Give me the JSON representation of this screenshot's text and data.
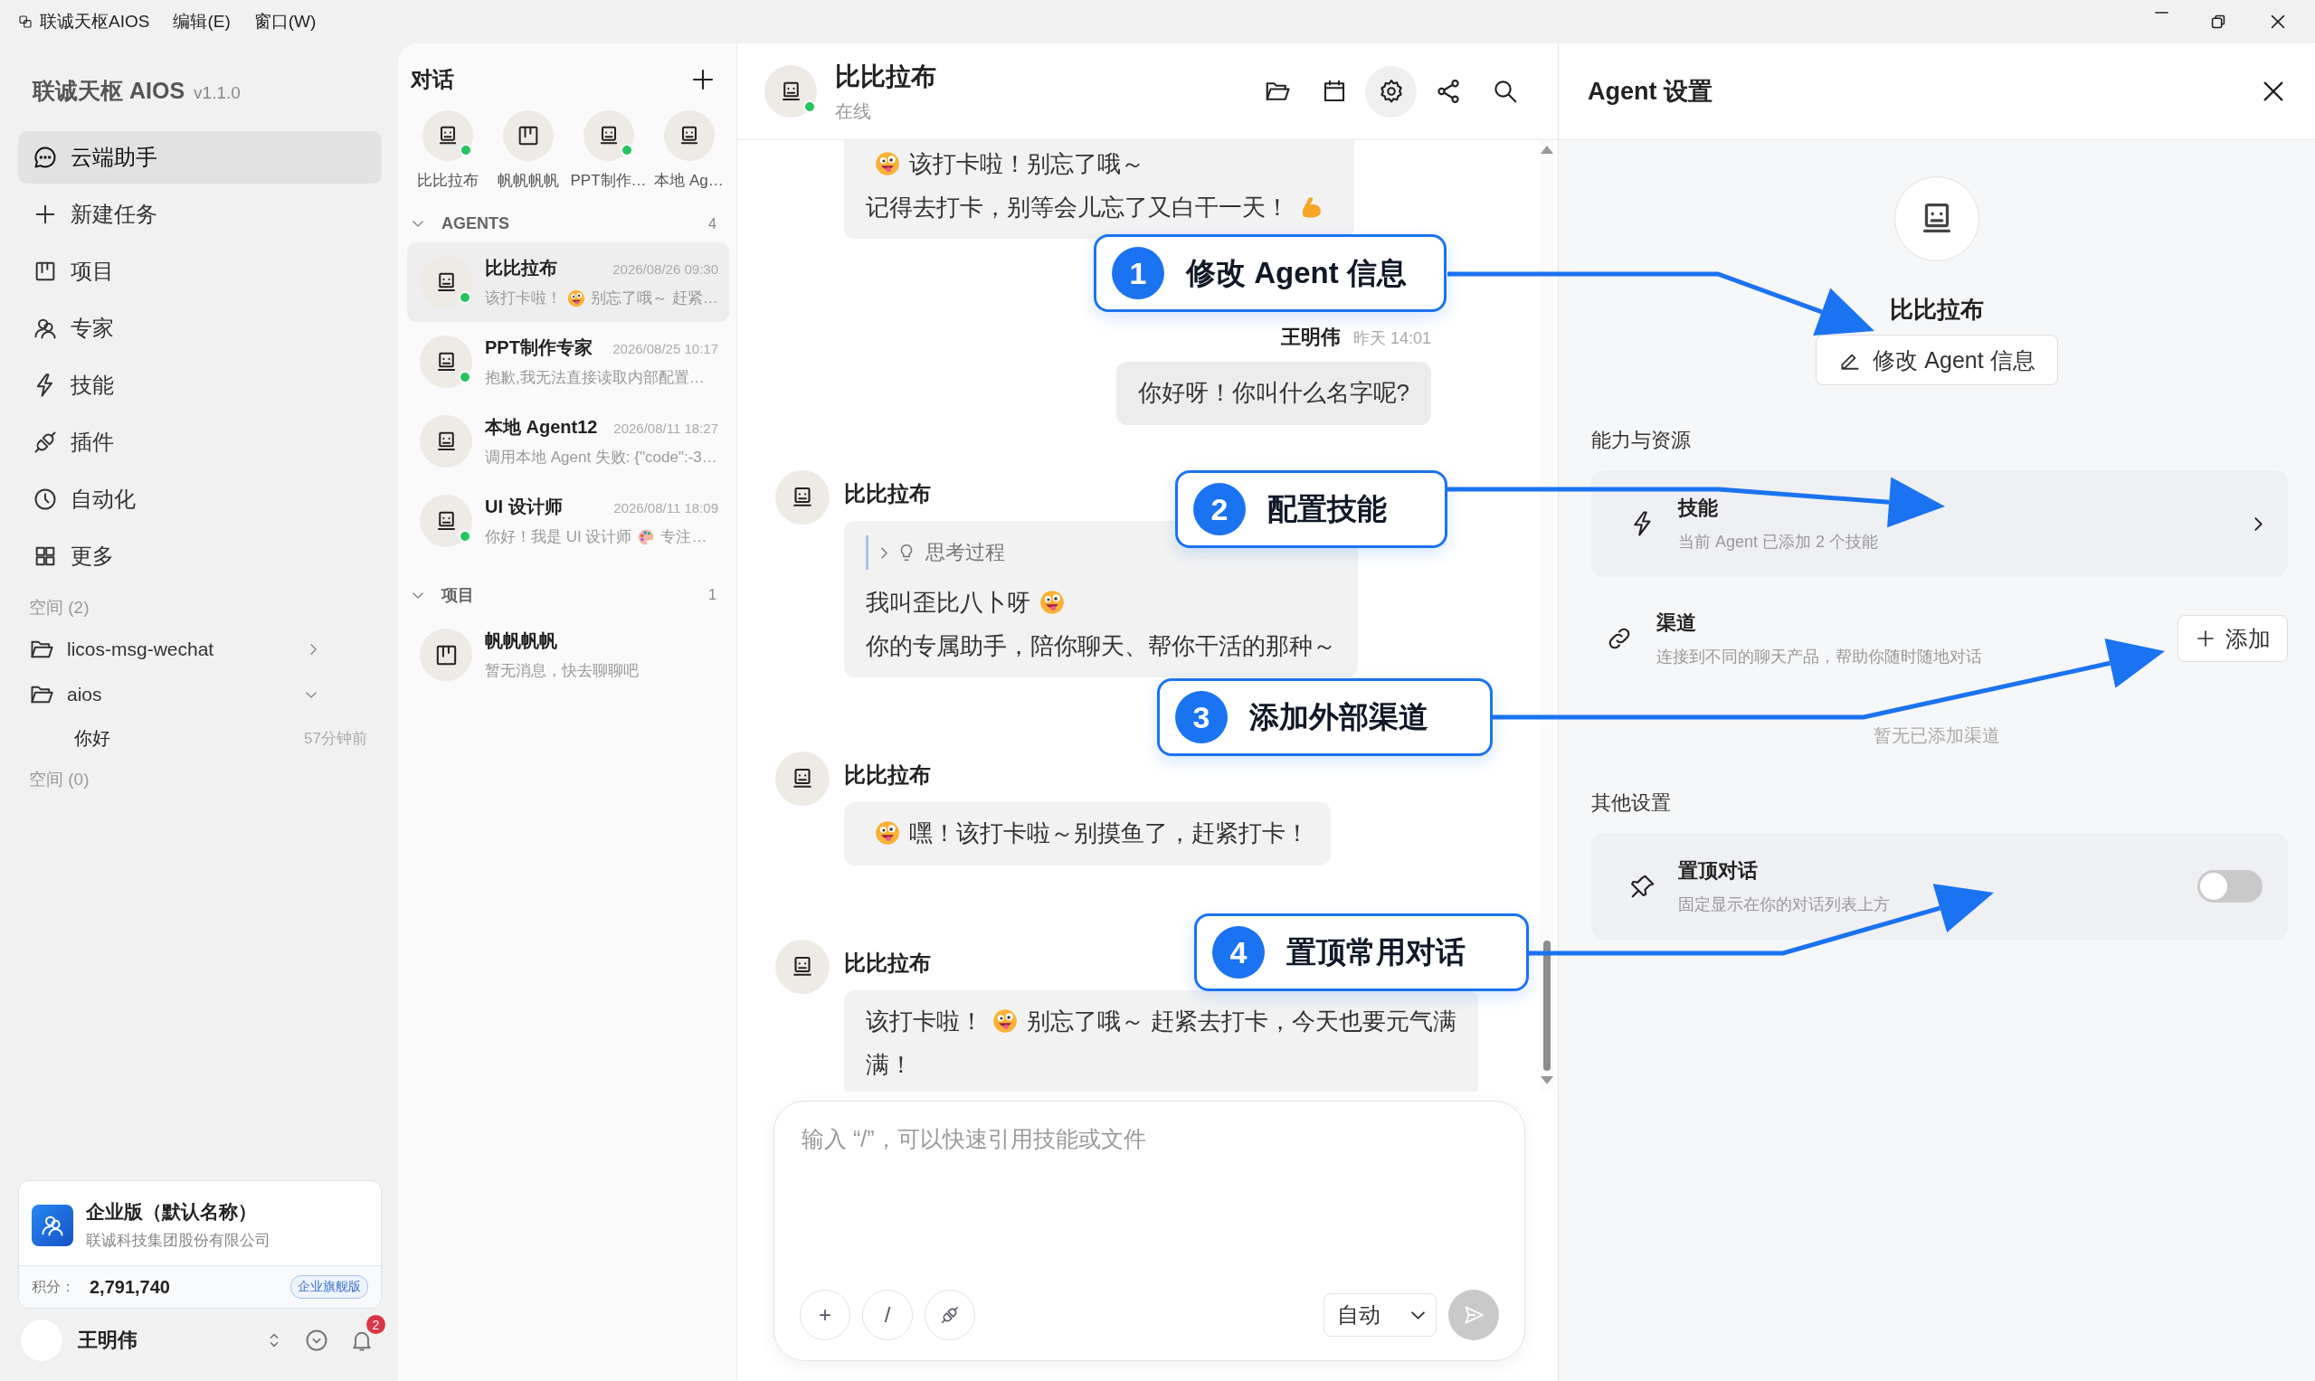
{
  "menu_bar": {
    "app": "联诚天枢AIOS",
    "items": [
      "编辑(E)",
      "窗口(W)"
    ]
  },
  "sidebar": {
    "brand": "联诚天枢 AIOS",
    "version": "v1.1.0",
    "nav": [
      {
        "label": "云端助手",
        "selected": true
      },
      {
        "label": "新建任务",
        "selected": false
      },
      {
        "label": "项目",
        "selected": false
      },
      {
        "label": "专家",
        "selected": false
      },
      {
        "label": "技能",
        "selected": false
      },
      {
        "label": "插件",
        "selected": false
      },
      {
        "label": "自动化",
        "selected": false
      },
      {
        "label": "更多",
        "selected": false
      }
    ],
    "spaces": [
      {
        "heading": "空间 (2)",
        "folders": [
          {
            "name": "licos-msg-wechat",
            "expanded": false
          },
          {
            "name": "aios",
            "expanded": true,
            "children": [
              {
                "title": "你好",
                "time": "57分钟前"
              }
            ]
          }
        ]
      },
      {
        "heading": "空间 (0)"
      }
    ],
    "org_card": {
      "name": "企业版（默认名称）",
      "company": "联诚科技集团股份有限公司",
      "points_label": "积分：",
      "points": "2,791,740",
      "plan": "企业旗舰版"
    },
    "user": {
      "name": "王明伟",
      "notifications": "2"
    }
  },
  "conversations": {
    "title": "对话",
    "recent": [
      {
        "label": "比比拉布",
        "kind": "agent",
        "online": true
      },
      {
        "label": "帆帆帆帆",
        "kind": "project",
        "online": false
      },
      {
        "label": "PPT制作…",
        "kind": "agent",
        "online": true
      },
      {
        "label": "本地 Ag…",
        "kind": "agent",
        "online": false
      }
    ],
    "groups": [
      {
        "title": "AGENTS",
        "count": "4",
        "expanded": true,
        "items": [
          {
            "name": "比比拉布",
            "time": "2026/08/26 09:30",
            "kind": "agent",
            "online": true,
            "selected": true,
            "preview": [
              {
                "kind": "text",
                "text": "该打卡啦！"
              },
              {
                "kind": "face"
              },
              {
                "kind": "text",
                "text": "别忘了哦～ 赶紧…"
              }
            ]
          },
          {
            "name": "PPT制作专家",
            "time": "2026/08/25 10:17",
            "kind": "agent",
            "online": true,
            "selected": false,
            "preview": [
              {
                "kind": "text",
                "text": "抱歉,我无法直接读取内部配置…"
              }
            ]
          },
          {
            "name": "本地 Agent12",
            "time": "2026/08/11 18:27",
            "kind": "agent",
            "online": false,
            "selected": false,
            "preview": [
              {
                "kind": "text",
                "text": "调用本地 Agent 失败: {\"code\":-3…"
              }
            ]
          },
          {
            "name": "UI 设计师",
            "time": "2026/08/11 18:09",
            "kind": "agent",
            "online": true,
            "selected": false,
            "preview": [
              {
                "kind": "text",
                "text": "你好！我是 UI 设计师"
              },
              {
                "kind": "palette"
              },
              {
                "kind": "text",
                "text": "专注…"
              }
            ]
          }
        ]
      },
      {
        "title": "项目",
        "count": "1",
        "expanded": true,
        "items": [
          {
            "name": "帆帆帆帆",
            "kind": "project",
            "online": false,
            "selected": false,
            "preview": [
              {
                "kind": "text",
                "text": "暂无消息，快去聊聊吧"
              }
            ]
          }
        ]
      }
    ]
  },
  "chat": {
    "name": "比比拉布",
    "status": "在线",
    "online": true,
    "tools": [
      {
        "selected": false
      },
      {
        "selected": false
      },
      {
        "selected": true
      },
      {
        "selected": false
      },
      {
        "selected": false
      }
    ],
    "messages": [
      {
        "kind": "agent",
        "lines": [
          [
            {
              "kind": "face"
            },
            {
              "kind": "text",
              "text": "该打卡啦！别忘了哦～"
            }
          ],
          [
            {
              "kind": "text",
              "text": "记得去打卡，别等会儿忘了又白干一天！"
            },
            {
              "kind": "muscle"
            }
          ]
        ]
      },
      {
        "kind": "user",
        "sender": "王明伟",
        "time": "昨天 14:01",
        "lines": [
          [
            {
              "kind": "text",
              "text": "你好呀！你叫什么名字呢?"
            }
          ]
        ]
      },
      {
        "kind": "agent",
        "sender": "比比拉布",
        "thinking": {
          "label": "思考过程",
          "expanded": false
        },
        "lines": [
          [
            {
              "kind": "text",
              "text": "我叫歪比八卜呀"
            },
            {
              "kind": "face"
            }
          ],
          [
            {
              "kind": "text",
              "text": "你的专属助手，陪你聊天、帮你干活的那种～"
            }
          ]
        ]
      },
      {
        "kind": "agent",
        "sender": "比比拉布",
        "lines": [
          [
            {
              "kind": "face"
            },
            {
              "kind": "text",
              "text": "嘿！该打卡啦～别摸鱼了，赶紧打卡！"
            }
          ]
        ]
      },
      {
        "kind": "agent",
        "sender": "比比拉布",
        "lines": [
          [
            {
              "kind": "text",
              "text": "该打卡啦！"
            },
            {
              "kind": "face"
            },
            {
              "kind": "text",
              "text": "别忘了哦～ 赶紧去打卡，今天也要元气满"
            }
          ],
          [
            {
              "kind": "text",
              "text": "满！"
            }
          ]
        ]
      }
    ],
    "input": {
      "placeholder": "输入 “/”，可以快速引用技能或文件",
      "tools": [
        "+",
        "/"
      ],
      "mode": "自动",
      "send_disabled": true
    }
  },
  "settings": {
    "title": "Agent 设置",
    "agent_name": "比比拉布",
    "edit_button": "修改 Agent 信息",
    "abilities_heading": "能力与资源",
    "skills": {
      "title": "技能",
      "description": "当前 Agent 已添加 2 个技能"
    },
    "channels": {
      "title": "渠道",
      "description": "连接到不同的聊天产品，帮助你随时随地对话",
      "add_button": "添加",
      "empty": "暂无已添加渠道"
    },
    "other_heading": "其他设置",
    "pin": {
      "title": "置顶对话",
      "description": "固定显示在你的对话列表上方",
      "on": false
    }
  },
  "annotations": [
    {
      "number": "1",
      "label": "修改 Agent 信息"
    },
    {
      "number": "2",
      "label": "配置技能"
    },
    {
      "number": "3",
      "label": "添加外部渠道"
    },
    {
      "number": "4",
      "label": "置顶常用对话"
    }
  ]
}
